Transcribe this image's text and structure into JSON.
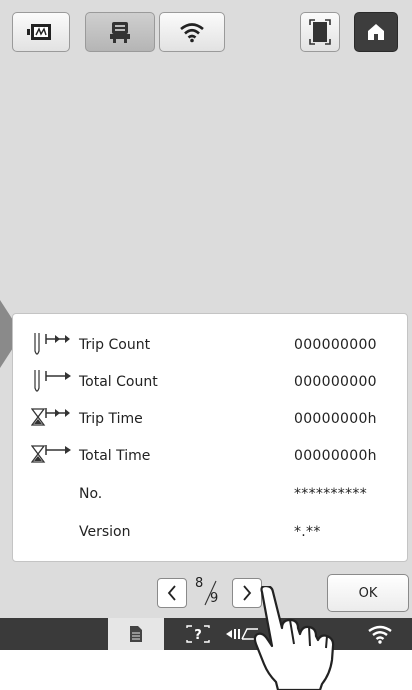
{
  "toolbar": {
    "icons": [
      "embroidery-frame-icon",
      "sewing-machine-icon",
      "wifi-icon",
      "scan-frame-icon",
      "home-icon"
    ]
  },
  "counters": [
    {
      "label": "Trip Count",
      "value": "000000000",
      "icon": "needle-arrow-icon"
    },
    {
      "label": "Total Count",
      "value": "000000000",
      "icon": "needle-arrow-icon"
    },
    {
      "label": "Trip Time",
      "value": "00000000h",
      "icon": "hourglass-arrow-icon"
    },
    {
      "label": "Total Time",
      "value": "00000000h",
      "icon": "hourglass-arrow-icon"
    },
    {
      "label": "No.",
      "value": "**********"
    },
    {
      "label": "Version",
      "value": "*.**"
    }
  ],
  "pager": {
    "current": "8",
    "total": "9",
    "ok_label": "OK"
  },
  "statusbar": {
    "icons": [
      "document-icon",
      "help-icon",
      "thread-cutter-icon",
      "wifi-icon"
    ]
  }
}
